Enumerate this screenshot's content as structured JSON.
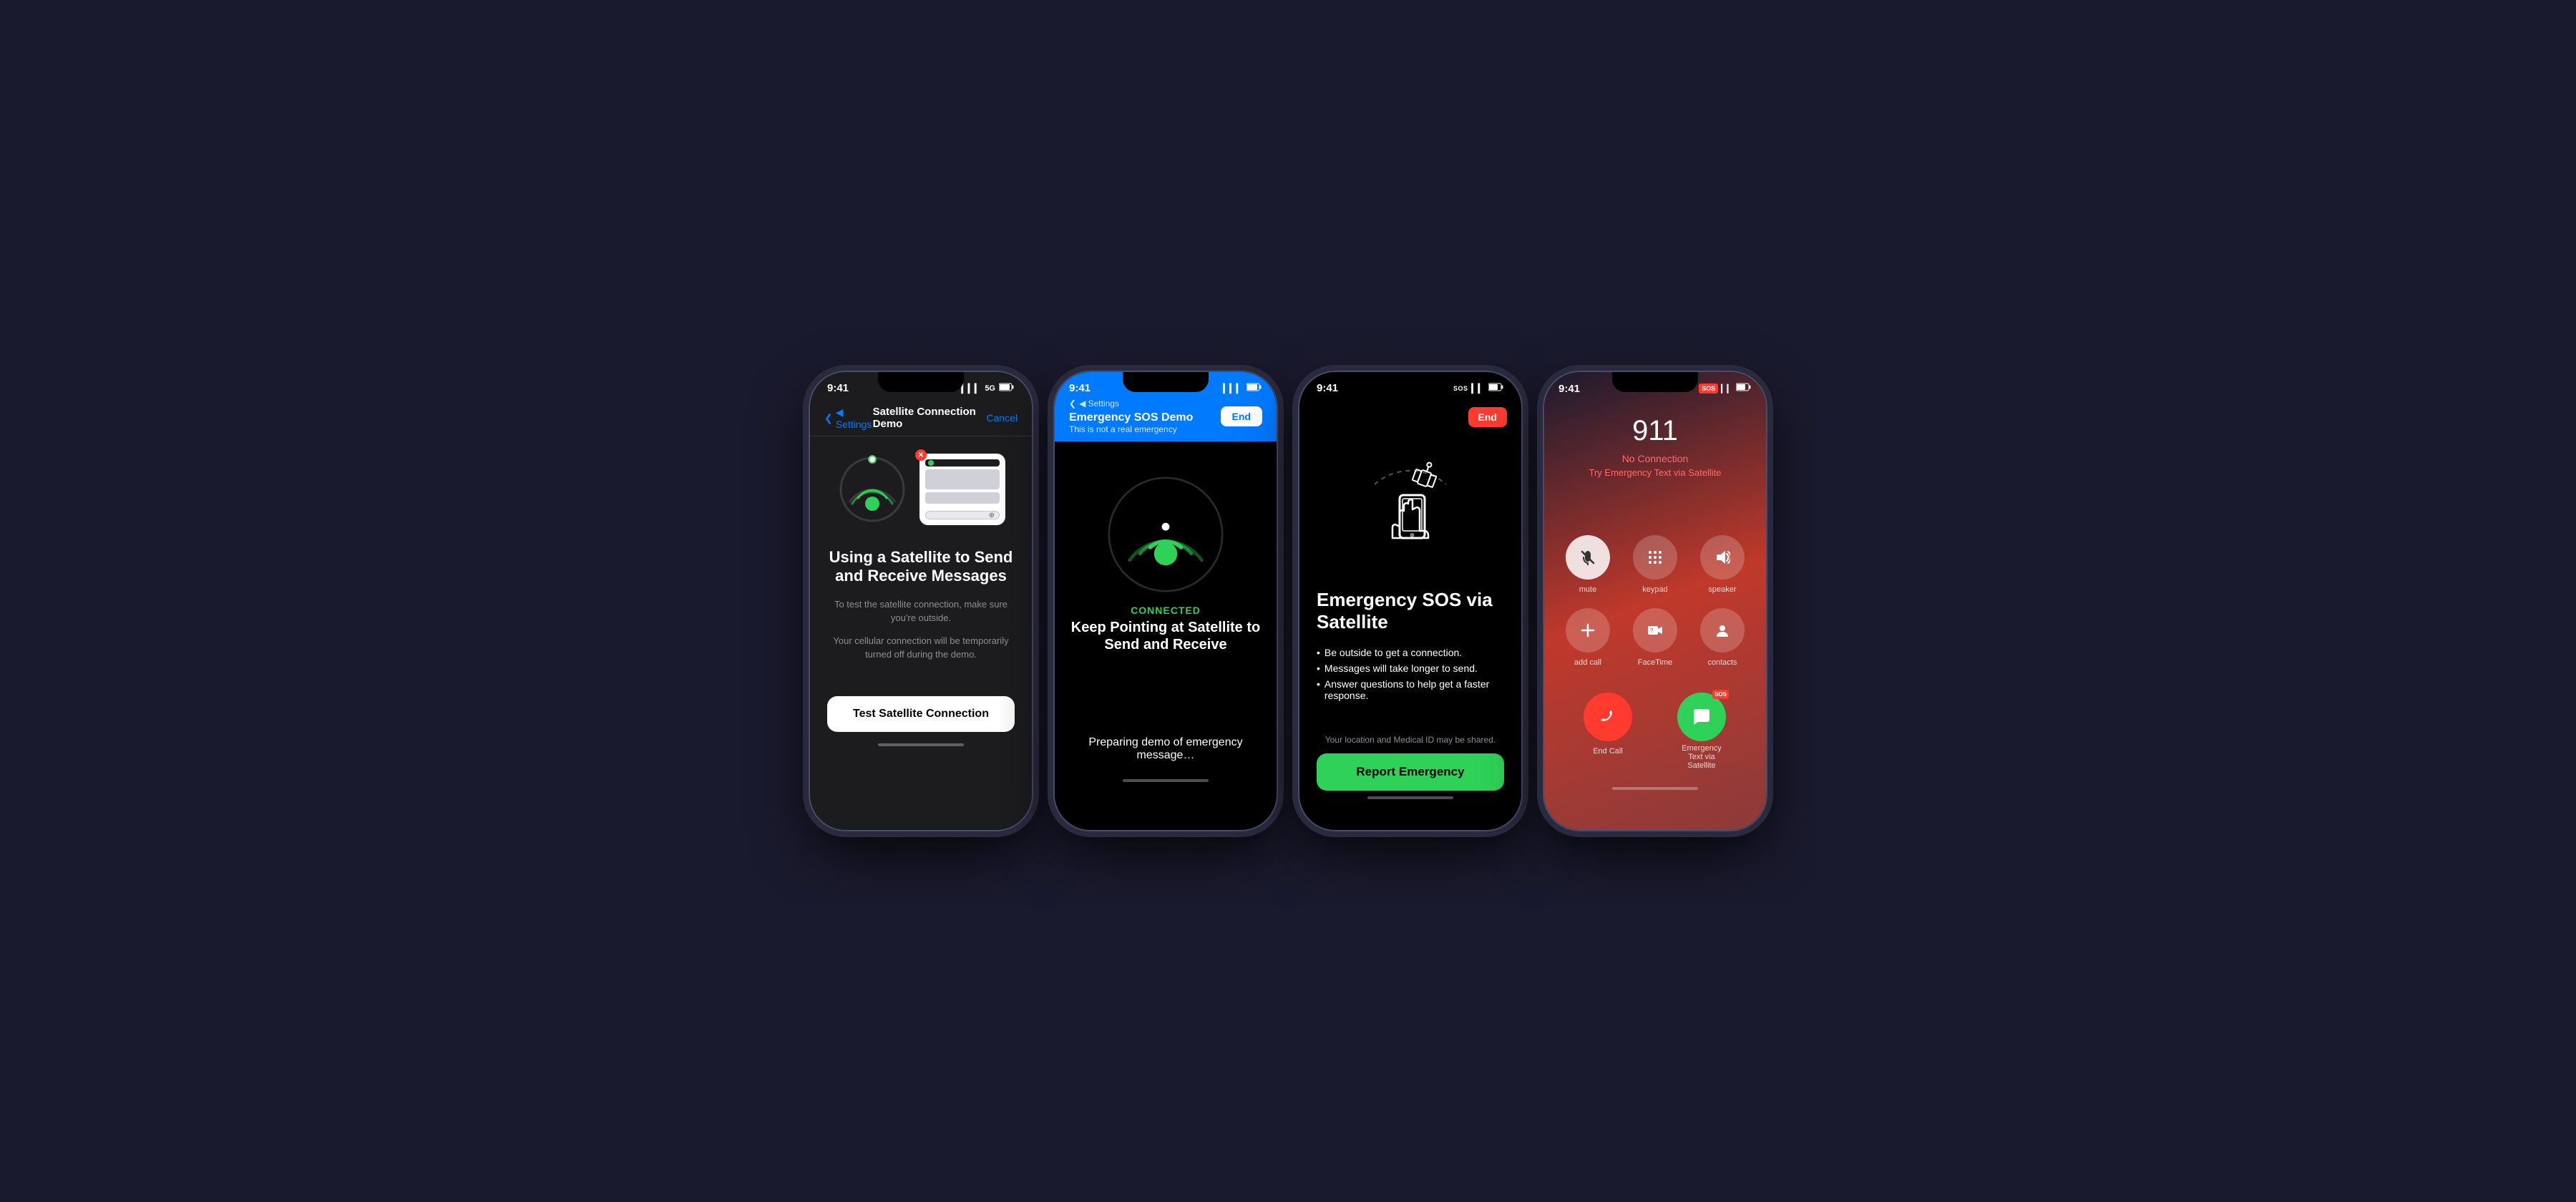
{
  "phone1": {
    "time": "9:41",
    "signal": "▎▎▎ 5G",
    "battery": "🔋",
    "back_label": "◀ Settings",
    "title": "Satellite Connection Demo",
    "cancel": "Cancel",
    "main_title": "Using a Satellite to Send and Receive Messages",
    "sub1": "To test the satellite connection, make sure you're outside.",
    "sub2": "Your cellular connection will be temporarily turned off during the demo.",
    "btn_label": "Test Satellite Connection"
  },
  "phone2": {
    "time": "9:41",
    "back_label": "◀ Settings",
    "sos_title": "Emergency SOS Demo",
    "sos_subtitle": "This is not a real emergency",
    "end_label": "End",
    "connected": "CONNECTED",
    "keep_pointing": "Keep Pointing at Satellite to Send and Receive",
    "preparing": "Preparing demo of emergency message…"
  },
  "phone3": {
    "time": "9:41",
    "end_label": "End",
    "main_title": "Emergency SOS via Satellite",
    "bullet1": "Be outside to get a connection.",
    "bullet2": "Messages will take longer to send.",
    "bullet3": "Answer questions to help get a faster response.",
    "location_text": "Your location and Medical ID may be shared.",
    "report_btn": "Report Emergency"
  },
  "phone4": {
    "time": "9:41",
    "number": "911",
    "no_connection": "No Connection",
    "satellite_text": "Try Emergency Text via Satellite",
    "mute_label": "mute",
    "keypad_label": "keypad",
    "speaker_label": "speaker",
    "add_call_label": "add call",
    "facetime_label": "FaceTime",
    "contacts_label": "contacts",
    "end_call_label": "End Call",
    "sos_action_label": "Emergency Text via Satellite"
  },
  "icons": {
    "back": "◀",
    "signal_bars": "●●●",
    "wifi": "▲",
    "battery": "▮▮▮",
    "phone": "📞",
    "mic_off": "🎤",
    "keypad": "⌨",
    "speaker": "🔊",
    "plus": "+",
    "video": "📷",
    "person": "👤",
    "message": "💬",
    "check": "✓",
    "x": "✕"
  }
}
